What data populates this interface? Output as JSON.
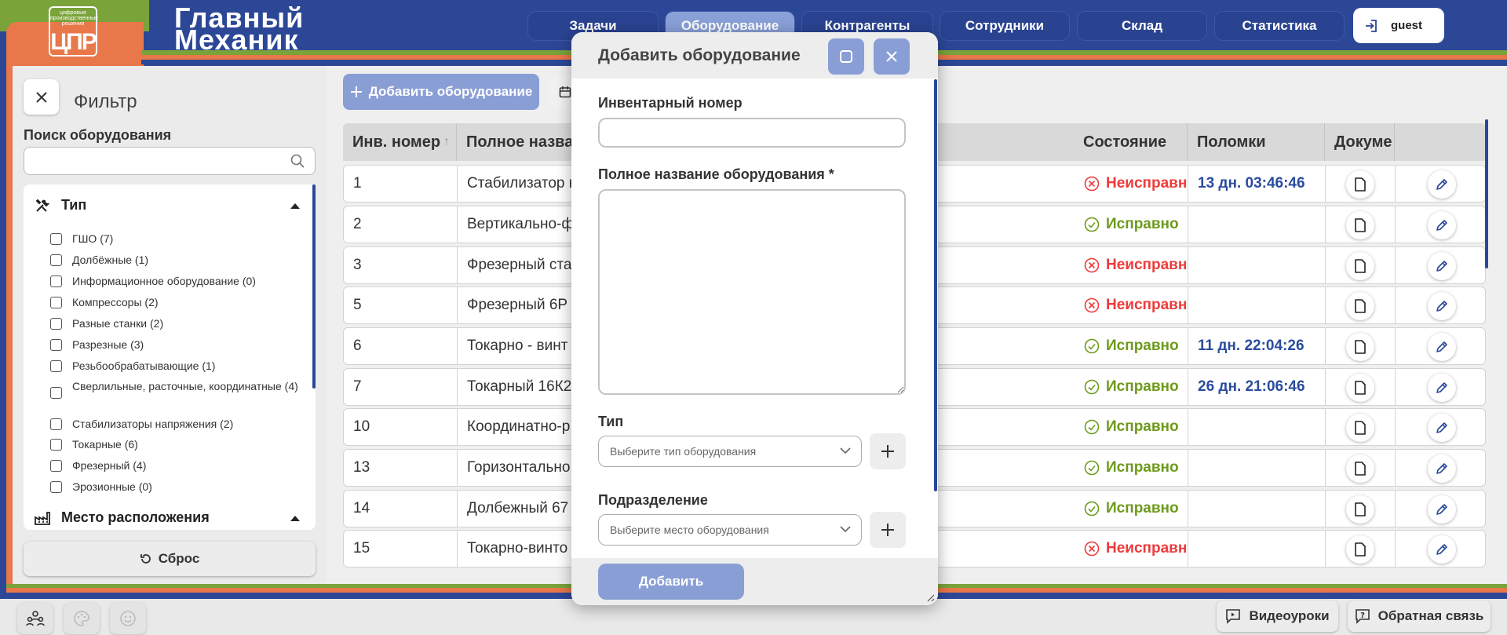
{
  "header": {
    "logo_caption": "цифровые производственные решения",
    "logo_letters": "ЦПР",
    "brand_line1": "Главный",
    "brand_line2": "Механик",
    "nav": [
      {
        "label": "Задачи",
        "active": false
      },
      {
        "label": "Оборудование",
        "active": true
      },
      {
        "label": "Контрагенты",
        "active": false
      },
      {
        "label": "Сотрудники",
        "active": false
      },
      {
        "label": "Склад",
        "active": false
      },
      {
        "label": "Статистика",
        "active": false
      }
    ],
    "user": "guest"
  },
  "filter": {
    "title": "Фильтр",
    "search_label": "Поиск оборудования",
    "search_placeholder": "",
    "type_section": "Тип",
    "types": [
      "ГШО (7)",
      "Долбёжные (1)",
      "Информационное оборудование (0)",
      "Компрессоры (2)",
      "Разные станки (2)",
      "Разрезные (3)",
      "Резьбообрабатывающие (1)",
      "Сверлильные, расточные, координатные (4)",
      "Стабилизаторы напряжения (2)",
      "Токарные (6)",
      "Фрезерный (4)",
      "Эрозионные (0)"
    ],
    "location_section": "Место расположения",
    "reset_label": "Сброс"
  },
  "toolbar": {
    "add_label": "Добавить оборудование"
  },
  "table": {
    "headers": {
      "inv": "Инв. номер",
      "name": "Полное назва",
      "state": "Состояние",
      "breakdowns": "Поломки",
      "docs": "Докуме"
    },
    "rows": [
      {
        "inv": "1",
        "name": "Стабилизатор н",
        "state": "Неисправн",
        "ok": false,
        "breakdown": "13 дн. 03:46:46"
      },
      {
        "inv": "2",
        "name": "Вертикально-ф",
        "state": "Исправно",
        "ok": true,
        "breakdown": ""
      },
      {
        "inv": "3",
        "name": "Фрезерный ста",
        "state": "Неисправн",
        "ok": false,
        "breakdown": ""
      },
      {
        "inv": "5",
        "name": "Фрезерный 6Р",
        "state": "Неисправн",
        "ok": false,
        "breakdown": ""
      },
      {
        "inv": "6",
        "name": "Токарно - винт",
        "state": "Исправно",
        "ok": true,
        "breakdown": "11 дн. 22:04:26"
      },
      {
        "inv": "7",
        "name": "Токарный 16К2",
        "state": "Исправно",
        "ok": true,
        "breakdown": "26 дн. 21:06:46"
      },
      {
        "inv": "10",
        "name": "Координатно-р",
        "state": "Исправно",
        "ok": true,
        "breakdown": ""
      },
      {
        "inv": "13",
        "name": "Горизонтально",
        "state": "Исправно",
        "ok": true,
        "breakdown": ""
      },
      {
        "inv": "14",
        "name": "Долбежный 67",
        "state": "Исправно",
        "ok": true,
        "breakdown": ""
      },
      {
        "inv": "15",
        "name": "Токарно-винто",
        "state": "Неисправн",
        "ok": false,
        "breakdown": ""
      }
    ]
  },
  "modal": {
    "title": "Добавить оборудование",
    "inv_label": "Инвентарный номер",
    "inv_value": "",
    "name_label": "Полное название оборудования *",
    "name_value": "",
    "type_label": "Тип",
    "type_placeholder": "Выберите тип оборудования",
    "dept_label": "Подразделение",
    "dept_placeholder": "Выберите место оборудования",
    "submit_label": "Добавить"
  },
  "bottom": {
    "video_label": "Видеоуроки",
    "feedback_label": "Обратная связь"
  },
  "colors": {
    "brand_blue": "#2c4796",
    "accent_button": "#8a9ed6",
    "ok_green": "#6e9a1c",
    "bad_red": "#ee3b3b",
    "breakdown_blue": "#2a4c9e"
  }
}
